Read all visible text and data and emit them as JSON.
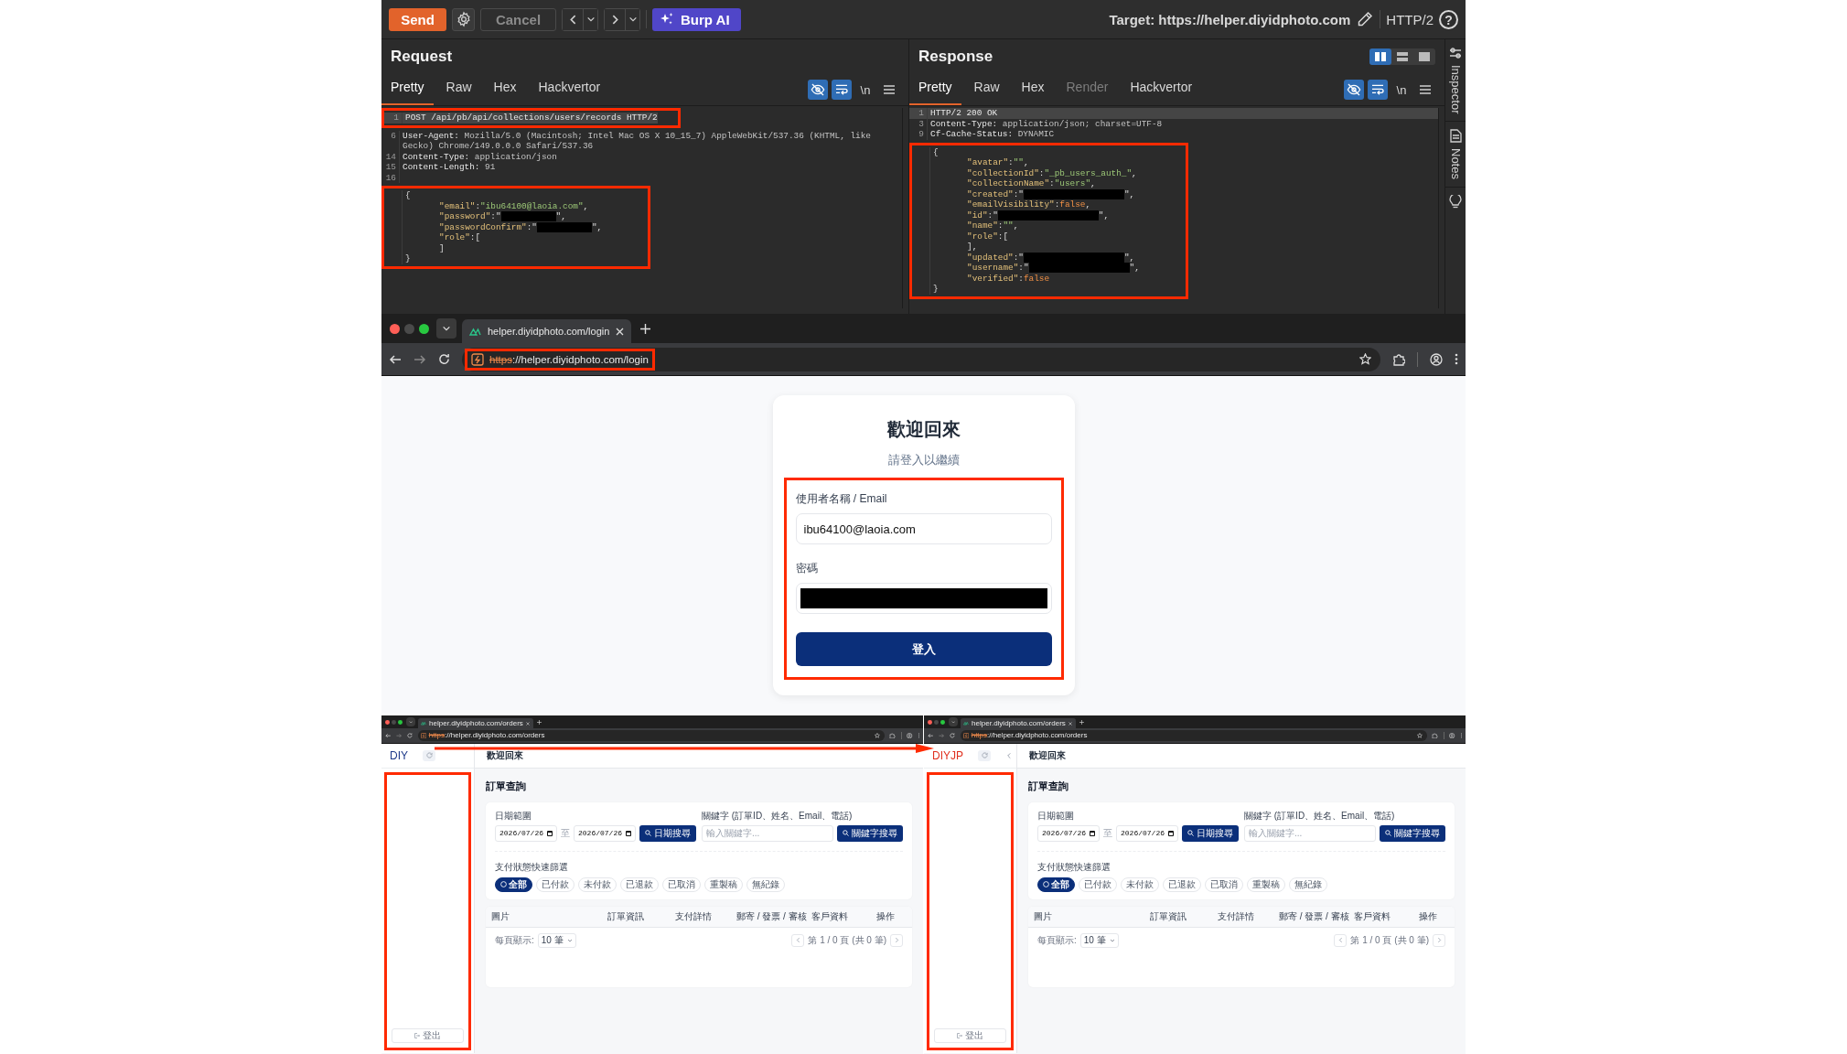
{
  "burp": {
    "toolbar": {
      "send": "Send",
      "cancel": {
        "label": "Cancel",
        "disabled": true
      },
      "ai": "Burp AI",
      "target": "Target: https://helper.diyidphoto.com",
      "protocol": "HTTP/2",
      "help": "?"
    },
    "request": {
      "title": "Request",
      "tabs": [
        {
          "label": "Pretty",
          "selected": true
        },
        {
          "label": "Raw",
          "selected": false
        },
        {
          "label": "Hex",
          "selected": false
        },
        {
          "label": "Hackvertor",
          "selected": false
        }
      ],
      "tools": [
        {
          "kind": "hide",
          "active": true
        },
        {
          "kind": "wrap",
          "active": true
        },
        {
          "kind": "newline",
          "label": "\\n",
          "active": false
        },
        {
          "kind": "menu",
          "active": false
        }
      ],
      "blocks": [
        {
          "boxed": true,
          "lines": [
            {
              "num": "1",
              "current": true,
              "parts": [
                {
                  "kind": "plain",
                  "text": "POST /api/pb/api/collections/users/records HTTP/2"
                }
              ]
            }
          ]
        },
        {
          "boxed": false,
          "lines": [
            {
              "num": "6",
              "current": false,
              "parts": [
                {
                  "kind": "name",
                  "text": "User-Agent:"
                },
                {
                  "kind": "value",
                  "text": " Mozilla/5.0 (Macintosh; Intel Mac OS X 10_15_7) AppleWebKit/537.36 (KHTML, like Gecko) Chrome/149.0.0.0 Safari/537.36"
                }
              ]
            },
            {
              "num": "14",
              "current": false,
              "parts": [
                {
                  "kind": "name",
                  "text": "Content-Type:"
                },
                {
                  "kind": "value",
                  "text": " application/json"
                }
              ]
            },
            {
              "num": "15",
              "current": false,
              "parts": [
                {
                  "kind": "name",
                  "text": "Content-Length:"
                },
                {
                  "kind": "value",
                  "text": " 91"
                }
              ]
            },
            {
              "num": "16",
              "current": false
            }
          ]
        },
        {
          "boxed": true,
          "lines": [
            {
              "current": false,
              "parts": [
                {
                  "kind": "punct",
                  "text": "{"
                }
              ]
            },
            {
              "current": false,
              "indented": true,
              "parts": [
                {
                  "kind": "key",
                  "text": "\"email\""
                },
                {
                  "kind": "punct",
                  "text": ":"
                },
                {
                  "kind": "string",
                  "text": "\"ibu64100@laoia.com\""
                },
                {
                  "kind": "punct",
                  "text": ","
                }
              ]
            },
            {
              "current": false,
              "indented": true,
              "parts": [
                {
                  "kind": "key",
                  "text": "\"password\""
                },
                {
                  "kind": "punct",
                  "text": ":\""
                },
                {
                  "kind": "redaction"
                },
                {
                  "kind": "punct",
                  "text": "\","
                }
              ]
            },
            {
              "current": false,
              "indented": true,
              "parts": [
                {
                  "kind": "key",
                  "text": "\"passwordConfirm\""
                },
                {
                  "kind": "punct",
                  "text": ":\""
                },
                {
                  "kind": "redaction"
                },
                {
                  "kind": "punct",
                  "text": "\","
                }
              ]
            },
            {
              "current": false,
              "indented": true,
              "parts": [
                {
                  "kind": "key",
                  "text": "\"role\""
                },
                {
                  "kind": "punct",
                  "text": ":["
                }
              ]
            },
            {
              "current": false,
              "indented": true,
              "parts": [
                {
                  "kind": "punct",
                  "text": "]"
                }
              ]
            },
            {
              "current": false,
              "parts": [
                {
                  "kind": "punct",
                  "text": "}"
                }
              ]
            }
          ]
        }
      ]
    },
    "response": {
      "title": "Response",
      "layouts": [
        {
          "kind": "columns",
          "selected": true
        },
        {
          "kind": "rows",
          "selected": false
        },
        {
          "kind": "single",
          "selected": false
        }
      ],
      "tabs": [
        {
          "label": "Pretty",
          "selected": true,
          "disabled": false
        },
        {
          "label": "Raw",
          "selected": false,
          "disabled": false
        },
        {
          "label": "Hex",
          "selected": false,
          "disabled": false
        },
        {
          "label": "Render",
          "selected": false,
          "disabled": true
        },
        {
          "label": "Hackvertor",
          "selected": false,
          "disabled": false
        }
      ],
      "tools": [
        {
          "kind": "hide",
          "active": true
        },
        {
          "kind": "wrap",
          "active": true
        },
        {
          "kind": "newline",
          "label": "\\n",
          "active": false
        },
        {
          "kind": "menu",
          "active": false
        }
      ],
      "blocks": [
        {
          "boxed": false,
          "lines": [
            {
              "num": "1",
              "current": true,
              "parts": [
                {
                  "kind": "plain",
                  "text": "HTTP/2 200 OK"
                }
              ]
            },
            {
              "num": "3",
              "current": false,
              "parts": [
                {
                  "kind": "name",
                  "text": "Content-Type:"
                },
                {
                  "kind": "value",
                  "text": " application/json; charset=UTF-8"
                }
              ]
            },
            {
              "num": "9",
              "current": false,
              "parts": [
                {
                  "kind": "name",
                  "text": "Cf-Cache-Status:"
                },
                {
                  "kind": "value",
                  "text": " DYNAMIC"
                }
              ]
            }
          ]
        },
        {
          "boxed": true,
          "lines": [
            {
              "current": false,
              "parts": [
                {
                  "kind": "punct",
                  "text": "{"
                }
              ]
            },
            {
              "current": false,
              "indented": true,
              "parts": [
                {
                  "kind": "key",
                  "text": "\"avatar\""
                },
                {
                  "kind": "punct",
                  "text": ":"
                },
                {
                  "kind": "string",
                  "text": "\"\""
                },
                {
                  "kind": "punct",
                  "text": ","
                }
              ]
            },
            {
              "current": false,
              "indented": true,
              "parts": [
                {
                  "kind": "key",
                  "text": "\"collectionId\""
                },
                {
                  "kind": "punct",
                  "text": ":"
                },
                {
                  "kind": "string",
                  "text": "\"_pb_users_auth_\""
                },
                {
                  "kind": "punct",
                  "text": ","
                }
              ]
            },
            {
              "current": false,
              "indented": true,
              "parts": [
                {
                  "kind": "key",
                  "text": "\"collectionName\""
                },
                {
                  "kind": "punct",
                  "text": ":"
                },
                {
                  "kind": "string",
                  "text": "\"users\""
                },
                {
                  "kind": "punct",
                  "text": ","
                }
              ]
            },
            {
              "current": false,
              "indented": true,
              "parts": [
                {
                  "kind": "key",
                  "text": "\"created\""
                },
                {
                  "kind": "punct",
                  "text": ":\""
                },
                {
                  "kind": "redaction"
                },
                {
                  "kind": "punct",
                  "text": "\","
                }
              ]
            },
            {
              "current": false,
              "indented": true,
              "parts": [
                {
                  "kind": "key",
                  "text": "\"emailVisibility\""
                },
                {
                  "kind": "punct",
                  "text": ":"
                },
                {
                  "kind": "keyword",
                  "text": "false"
                },
                {
                  "kind": "punct",
                  "text": ","
                }
              ]
            },
            {
              "current": false,
              "indented": true,
              "parts": [
                {
                  "kind": "key",
                  "text": "\"id\""
                },
                {
                  "kind": "punct",
                  "text": ":\""
                },
                {
                  "kind": "redaction"
                },
                {
                  "kind": "punct",
                  "text": "\","
                }
              ]
            },
            {
              "current": false,
              "indented": true,
              "parts": [
                {
                  "kind": "key",
                  "text": "\"name\""
                },
                {
                  "kind": "punct",
                  "text": ":"
                },
                {
                  "kind": "string",
                  "text": "\"\""
                },
                {
                  "kind": "punct",
                  "text": ","
                }
              ]
            },
            {
              "current": false,
              "indented": true,
              "parts": [
                {
                  "kind": "key",
                  "text": "\"role\""
                },
                {
                  "kind": "punct",
                  "text": ":["
                }
              ]
            },
            {
              "current": false,
              "indented": true,
              "parts": [
                {
                  "kind": "punct",
                  "text": "],"
                }
              ]
            },
            {
              "current": false,
              "indented": true,
              "parts": [
                {
                  "kind": "key",
                  "text": "\"updated\""
                },
                {
                  "kind": "punct",
                  "text": ":\""
                },
                {
                  "kind": "redaction"
                },
                {
                  "kind": "punct",
                  "text": "\","
                }
              ]
            },
            {
              "current": false,
              "indented": true,
              "parts": [
                {
                  "kind": "key",
                  "text": "\"username\""
                },
                {
                  "kind": "punct",
                  "text": ":\""
                },
                {
                  "kind": "redaction"
                },
                {
                  "kind": "punct",
                  "text": "\","
                }
              ]
            },
            {
              "current": false,
              "indented": true,
              "parts": [
                {
                  "kind": "key",
                  "text": "\"verified\""
                },
                {
                  "kind": "punct",
                  "text": ":"
                },
                {
                  "kind": "keyword",
                  "text": "false"
                }
              ]
            },
            {
              "current": false,
              "parts": [
                {
                  "kind": "punct",
                  "text": "}"
                }
              ]
            }
          ]
        }
      ]
    },
    "side_tabs": [
      {
        "kind": "inspector",
        "label": "Inspector"
      },
      {
        "kind": "notes",
        "label": "Notes"
      },
      {
        "kind": "tips"
      }
    ]
  },
  "browser": {
    "tab_title": "helper.diyidphoto.com/login",
    "url": "https://helper.diyidphoto.com/login",
    "insecure": true,
    "url_boxed": true
  },
  "login": {
    "title": "歡迎回來",
    "subtitle": "請登入以繼續",
    "form_boxed": true,
    "fields": [
      {
        "kind": "text",
        "label": "使用者名稱 / Email",
        "value": "ibu64100@laoia.com"
      },
      {
        "kind": "redacted",
        "label": "密碼"
      }
    ],
    "submit": "登入"
  },
  "screens": [
    {
      "tab_title": "helper.diyidphoto.com/orders",
      "url": "https://helper.diyidphoto.com/orders",
      "insecure": true,
      "logo": "DIY",
      "color": "#1e3a8a",
      "collapse_button": false,
      "header_title": "歡迎回來",
      "sidebar_boxed": true,
      "logout": "登出",
      "page_title": "訂單查詢",
      "date_label": "日期範圍",
      "date_from": "2026/07/26",
      "date_sep": "至",
      "date_to": "2026/07/26",
      "date_button": "日期搜尋",
      "keyword_label": "關鍵字 (訂單ID、姓名、Email、電話)",
      "keyword_placeholder": "輸入關鍵字...",
      "keyword_button": "關鍵字搜尋",
      "filter_label": "支付狀態快速篩選",
      "chips": [
        {
          "label": "全部",
          "selected": true
        },
        {
          "label": "已付款",
          "selected": false
        },
        {
          "label": "未付款",
          "selected": false
        },
        {
          "label": "已退款",
          "selected": false
        },
        {
          "label": "已取消",
          "selected": false
        },
        {
          "label": "重製稿",
          "selected": false
        },
        {
          "label": "無紀錄",
          "selected": false
        }
      ],
      "columns": [
        "圖片",
        "訂單資訊",
        "支付詳情",
        "郵寄 / 發票 / 審核",
        "客戶資料",
        "操作"
      ],
      "per_page_label": "每頁顯示:",
      "per_page": "10 筆",
      "page_info": "第 1 / 0 頁 (共 0 筆)"
    },
    {
      "tab_title": "helper.diyidphoto.com/orders",
      "url": "https://helper.diyidphoto.com/orders",
      "insecure": true,
      "logo": "DIYJP",
      "color": "#e0301e",
      "collapse_button": true,
      "header_title": "歡迎回來",
      "sidebar_boxed": true,
      "logout": "登出",
      "page_title": "訂單查詢",
      "date_label": "日期範圍",
      "date_from": "2026/07/26",
      "date_sep": "至",
      "date_to": "2026/07/26",
      "date_button": "日期搜尋",
      "keyword_label": "關鍵字 (訂單ID、姓名、Email、電話)",
      "keyword_placeholder": "輸入關鍵字...",
      "keyword_button": "關鍵字搜尋",
      "filter_label": "支付狀態快速篩選",
      "chips": [
        {
          "label": "全部",
          "selected": true
        },
        {
          "label": "已付款",
          "selected": false
        },
        {
          "label": "未付款",
          "selected": false
        },
        {
          "label": "已退款",
          "selected": false
        },
        {
          "label": "已取消",
          "selected": false
        },
        {
          "label": "重製稿",
          "selected": false
        },
        {
          "label": "無紀錄",
          "selected": false
        }
      ],
      "columns": [
        "圖片",
        "訂單資訊",
        "支付詳情",
        "郵寄 / 發票 / 審核",
        "客戶資料",
        "操作"
      ],
      "per_page_label": "每頁顯示:",
      "per_page": "10 筆",
      "page_info": "第 1 / 0 頁 (共 0 筆)"
    }
  ]
}
